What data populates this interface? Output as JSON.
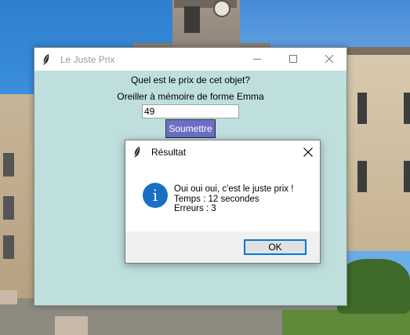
{
  "main_window": {
    "title": "Le Juste Prix",
    "icon": "feather-icon",
    "question": "Quel est le prix de cet objet?",
    "product": "Oreiller à mémoire de forme Emma",
    "price_value": "49",
    "submit_label": "Soumettre",
    "background_color": "#bfdfdf",
    "submit_color": "#6b6fc6"
  },
  "dialog": {
    "title": "Résultat",
    "icon": "info-icon",
    "info_glyph": "i",
    "message_lines": [
      "Oui oui oui, c'est le juste prix !",
      "Temps : 12 secondes",
      "Erreurs : 3"
    ],
    "ok_label": "OK",
    "accent_color": "#0078d7"
  },
  "window_controls": {
    "minimize": "minimize-icon",
    "maximize": "maximize-icon",
    "close": "close-icon"
  }
}
